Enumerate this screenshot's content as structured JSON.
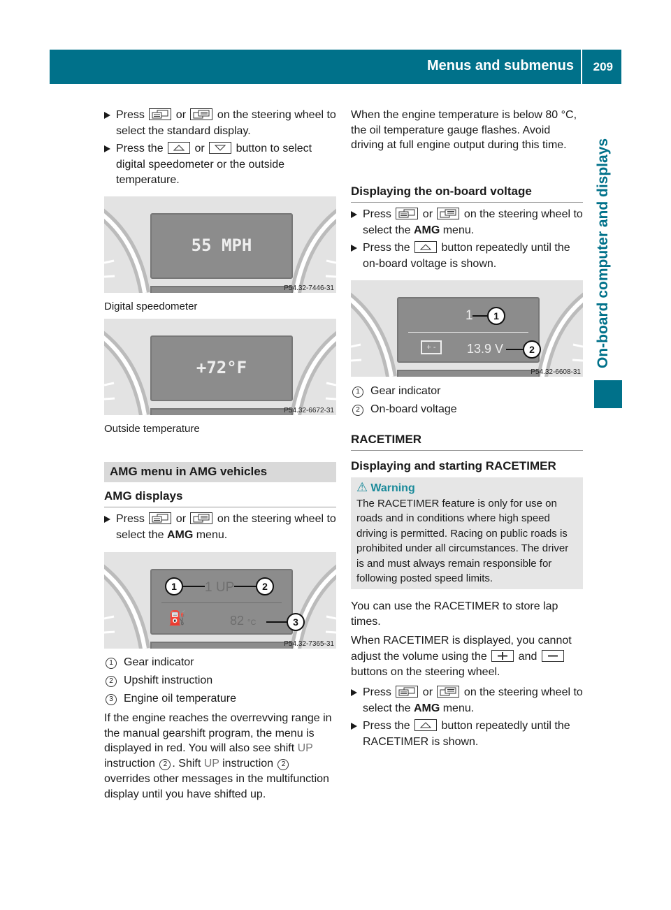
{
  "header": {
    "title": "Menus and submenus",
    "page_number": "209",
    "color": "#00718a"
  },
  "side_tab": {
    "label": "On-board computer and displays"
  },
  "left": {
    "bullets_top": [
      [
        {
          "t": "Press "
        },
        {
          "icon": "display-button-left"
        },
        {
          "t": " or "
        },
        {
          "icon": "display-button-right"
        },
        {
          "t": " on the steering wheel to select the standard display."
        }
      ],
      [
        {
          "t": "Press the "
        },
        {
          "icon": "up-button"
        },
        {
          "t": " or "
        },
        {
          "icon": "down-button"
        },
        {
          "t": " button to select digital speedometer or the outside temperature."
        }
      ]
    ],
    "figure1": {
      "display_text": "55 MPH",
      "code": "P54.32-7446-31",
      "caption": "Digital speedometer"
    },
    "figure2": {
      "display_text": "+72°F",
      "code": "P54.32-6672-31",
      "caption": "Outside temperature"
    },
    "section_bar": "AMG menu in AMG vehicles",
    "heading": "AMG displays",
    "bullets_amg": [
      [
        {
          "t": "Press "
        },
        {
          "icon": "display-button-left"
        },
        {
          "t": " or "
        },
        {
          "icon": "display-button-right"
        },
        {
          "t": " on the steering wheel to select the "
        },
        {
          "b": "AMG"
        },
        {
          "t": " menu."
        }
      ]
    ],
    "figure3": {
      "gear_text": "1 UP",
      "temp_text": "82",
      "temp_unit": "°C",
      "code": "P54.32-7365-31",
      "callouts": [
        "1",
        "2",
        "3"
      ]
    },
    "legend": [
      {
        "n": "1",
        "label": "Gear indicator"
      },
      {
        "n": "2",
        "label": "Upshift instruction"
      },
      {
        "n": "3",
        "label": "Engine oil temperature"
      }
    ],
    "paragraph": [
      {
        "t": "If the engine reaches the overrevving range in the manual gearshift program, the menu is displayed in red. You will also see shift "
      },
      {
        "g": "UP"
      },
      {
        "t": " instruction "
      },
      {
        "n": "2"
      },
      {
        "t": ". Shift "
      },
      {
        "g": "UP"
      },
      {
        "t": " instruction "
      },
      {
        "n": "2"
      },
      {
        "t": " overrides other messages in the multifunction display until you have shifted up."
      }
    ]
  },
  "right": {
    "paragraph_top": "When the engine temperature is below 80 °C, the oil temperature gauge flashes. Avoid driving at full engine output during this time.",
    "heading_voltage": "Displaying the on-board voltage",
    "bullets_voltage": [
      [
        {
          "t": "Press "
        },
        {
          "icon": "display-button-left"
        },
        {
          "t": " or "
        },
        {
          "icon": "display-button-right"
        },
        {
          "t": " on the steering wheel to select the "
        },
        {
          "b": "AMG"
        },
        {
          "t": " menu."
        }
      ],
      [
        {
          "t": "Press the "
        },
        {
          "icon": "up-button"
        },
        {
          "t": " button repeatedly until the on-board voltage is shown."
        }
      ]
    ],
    "figure4": {
      "gear_text": "1",
      "voltage_text": "13.9 V",
      "code": "P54.32-6608-31",
      "callouts": [
        "1",
        "2"
      ]
    },
    "legend": [
      {
        "n": "1",
        "label": "Gear indicator"
      },
      {
        "n": "2",
        "label": "On-board voltage"
      }
    ],
    "heading_racetimer": "RACETIMER",
    "heading_start": "Displaying and starting RACETIMER",
    "warning": {
      "title": "Warning",
      "text": "The RACETIMER feature is only for use on roads and in conditions where high speed driving is permitted. Racing on public roads is prohibited under all circumstances. The driver is and must always remain responsible for following posted speed limits.",
      "color": "#1a8a9a"
    },
    "paragraph_store": "You can use the RACETIMER to store lap times.",
    "paragraph_volume": [
      {
        "t": "When RACETIMER is displayed, you cannot adjust the volume using the "
      },
      {
        "icon": "plus-button"
      },
      {
        "t": " and "
      },
      {
        "icon": "minus-button"
      },
      {
        "t": " buttons on the steering wheel."
      }
    ],
    "bullets_race": [
      [
        {
          "t": "Press "
        },
        {
          "icon": "display-button-left"
        },
        {
          "t": " or "
        },
        {
          "icon": "display-button-right"
        },
        {
          "t": " on the steering wheel to select the "
        },
        {
          "b": "AMG"
        },
        {
          "t": " menu."
        }
      ],
      [
        {
          "t": "Press the "
        },
        {
          "icon": "up-button"
        },
        {
          "t": " button repeatedly until the RACETIMER is shown."
        }
      ]
    ]
  }
}
